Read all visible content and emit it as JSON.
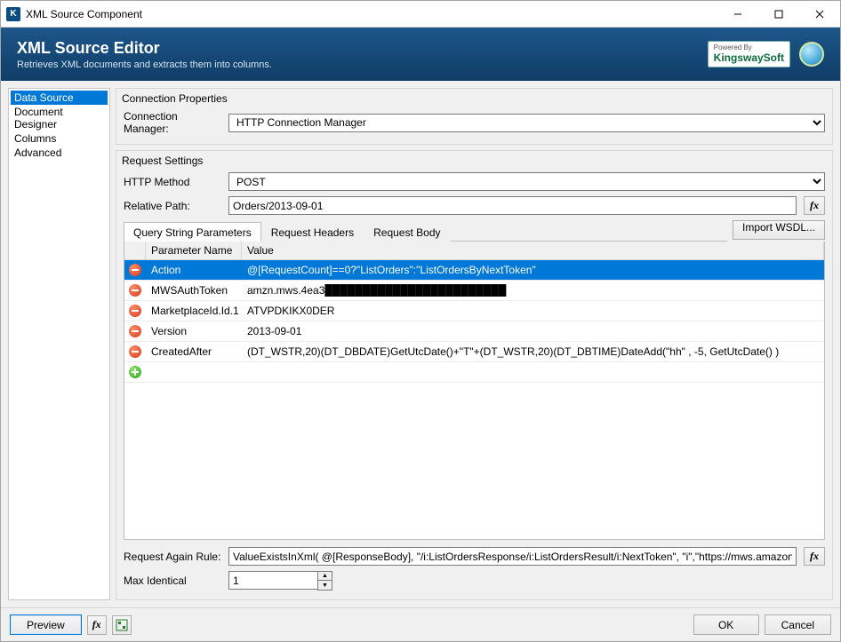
{
  "window": {
    "title": "XML Source Component"
  },
  "header": {
    "title": "XML Source Editor",
    "subtitle": "Retrieves XML documents and extracts them into columns.",
    "powered_by": "Powered By",
    "brand": "KingswaySoft"
  },
  "sidebar": {
    "items": [
      {
        "label": "Data Source",
        "selected": true
      },
      {
        "label": "Document Designer",
        "selected": false
      },
      {
        "label": "Columns",
        "selected": false
      },
      {
        "label": "Advanced",
        "selected": false
      }
    ]
  },
  "conn": {
    "group_title": "Connection Properties",
    "manager_label": "Connection Manager:",
    "manager_value": "HTTP Connection Manager"
  },
  "req": {
    "group_title": "Request Settings",
    "method_label": "HTTP Method",
    "method_value": "POST",
    "relpath_label": "Relative Path:",
    "relpath_value": "Orders/2013-09-01",
    "import_wsdl": "Import WSDL...",
    "tabs": [
      {
        "label": "Query String Parameters",
        "active": true
      },
      {
        "label": "Request Headers",
        "active": false
      },
      {
        "label": "Request Body",
        "active": false
      }
    ],
    "grid": {
      "col_name": "Parameter Name",
      "col_value": "Value",
      "rows": [
        {
          "name": "Action",
          "value": "@[RequestCount]==0?\"ListOrders\":\"ListOrdersByNextToken\"",
          "selected": true
        },
        {
          "name": "MWSAuthToken",
          "value": "amzn.mws.4ea3████████████████████████",
          "selected": false
        },
        {
          "name": "MarketplaceId.Id.1",
          "value": "ATVPDKIKX0DER",
          "selected": false
        },
        {
          "name": "Version",
          "value": "2013-09-01",
          "selected": false
        },
        {
          "name": "CreatedAfter",
          "value": "(DT_WSTR,20)(DT_DBDATE)GetUtcDate()+\"T\"+(DT_WSTR,20)(DT_DBTIME)DateAdd(\"hh\" , -5, GetUtcDate() )",
          "selected": false
        }
      ]
    },
    "again_label": "Request Again Rule:",
    "again_value": "ValueExistsInXml( @[ResponseBody], \"/i:ListOrdersResponse/i:ListOrdersResult/i:NextToken\", \"i\",\"https://mws.amazonservices.com/O",
    "max_identical_label": "Max Identical",
    "max_identical_value": "1"
  },
  "footer": {
    "preview": "Preview",
    "ok": "OK",
    "cancel": "Cancel"
  }
}
